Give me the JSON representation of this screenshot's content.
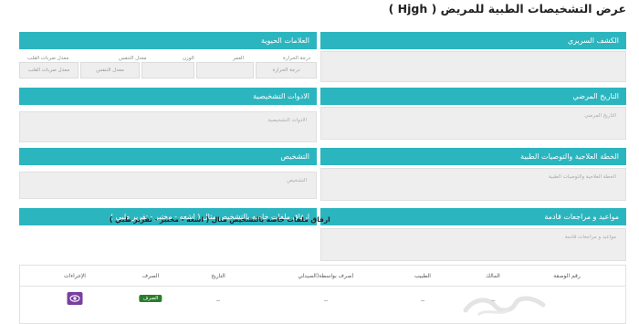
{
  "page": {
    "title": "عرض التشخيصات الطبية للمريض ( Hjgh )"
  },
  "sections": {
    "clinical_exam": {
      "title": "الكشف السريري"
    },
    "vital_signs": {
      "title": "العلامات الحيوية",
      "labels": {
        "heart_rate": "معدل ضربات القلب",
        "respiration": "معدل التنفس",
        "weight": "الوزن",
        "age": "العمر",
        "temperature": "درجة الحرارة"
      },
      "placeholders": {
        "heart_rate": "معدل ضربات القلب",
        "respiration": "معدل التنفس",
        "temperature": "درجة الحرارة"
      }
    },
    "medical_history": {
      "title": "التاريخ المرضي",
      "placeholder": "التاريخ المرضي"
    },
    "diagnostic_tools": {
      "title": "الادوات التشخيصية",
      "placeholder": "الادوات التشخيصية"
    },
    "treatment_plan": {
      "title": "الخطة العلاجية والتوصيات الطبية",
      "placeholder": "الخطة العلاجية والتوصيات الطبية"
    },
    "diagnosis": {
      "title": "التشخيص",
      "placeholder": "التشخيص"
    },
    "appointments": {
      "title": "مواعيد و مراجعات قادمة",
      "placeholder": "مواعيد و مراجعات قادمة"
    },
    "attachments": {
      "title": "ارفاق ملفات خاصه بالتشخيص مثال ( اشعه - مختبر - تقرير طبي )"
    }
  },
  "table": {
    "headers": [
      "رقم الوصفة",
      "المالك",
      "الطبيب",
      "(صرف بواسطة(الصيدلي",
      "التاريخ",
      "الصرف",
      "الإجراءات"
    ],
    "rows": [
      {
        "owner": "--",
        "doctor": "--",
        "dispensed_by": "--",
        "date": "--",
        "status": "الصرف"
      }
    ]
  },
  "colors": {
    "accent": "#2bb5bf",
    "action": "#7b3fa0",
    "badge": "#2a7d2e"
  },
  "icons": {
    "action": "eye-icon"
  }
}
